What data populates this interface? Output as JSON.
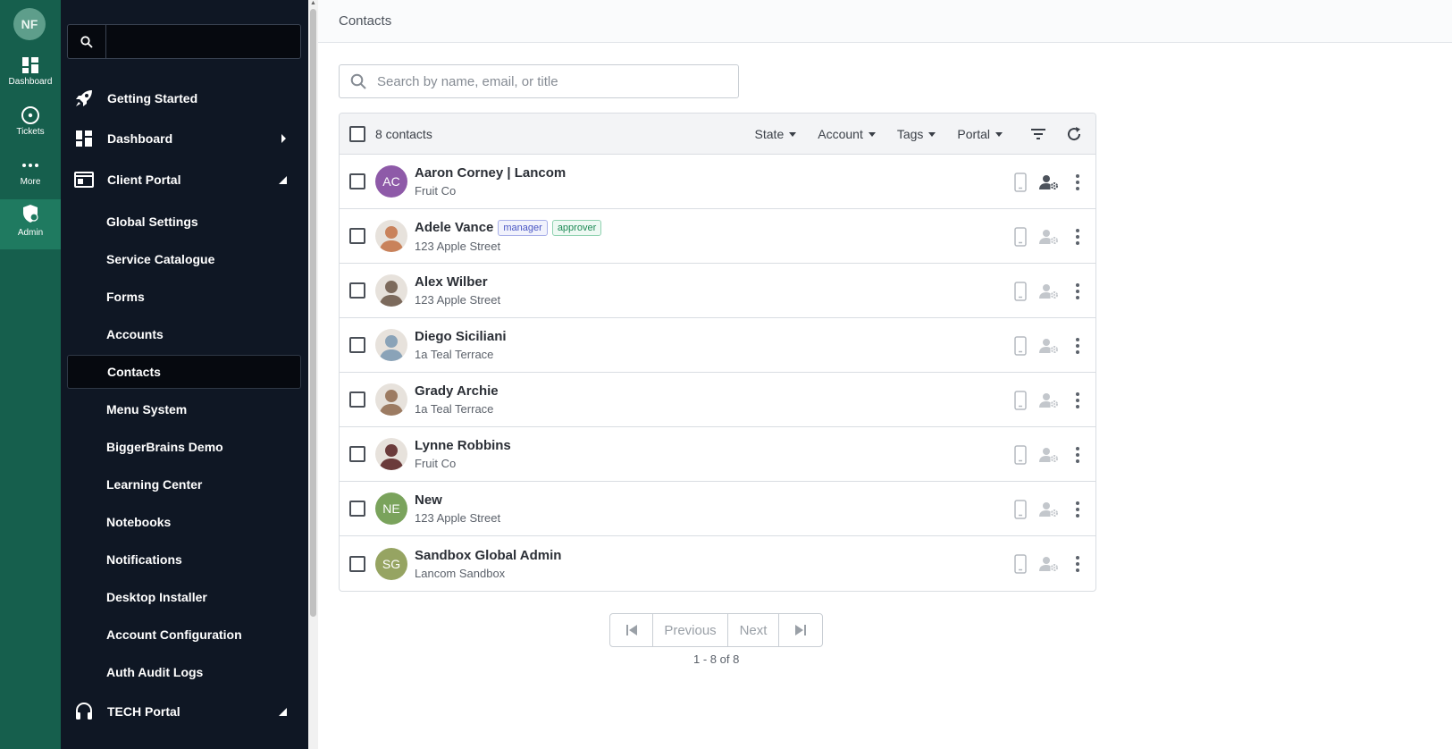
{
  "rail": {
    "avatar_initials": "NF",
    "items": [
      {
        "label": "Dashboard",
        "icon": "dashboard-grid-icon"
      },
      {
        "label": "Tickets",
        "icon": "ticket-circle-icon"
      },
      {
        "label": "More",
        "icon": "more-dots-icon"
      },
      {
        "label": "Admin",
        "icon": "admin-shield-icon"
      }
    ]
  },
  "sidebar": {
    "search_placeholder": "",
    "top_items": [
      {
        "label": "Getting Started",
        "icon": "rocket-icon"
      },
      {
        "label": "Dashboard",
        "icon": "dashboard-grid-icon"
      },
      {
        "label": "Client Portal",
        "icon": "browser-window-icon"
      },
      {
        "label": "TECH Portal",
        "icon": "headset-icon"
      }
    ],
    "sub_items": [
      "Global Settings",
      "Service Catalogue",
      "Forms",
      "Accounts",
      "Contacts",
      "Menu System",
      "BiggerBrains Demo",
      "Learning Center",
      "Notebooks",
      "Notifications",
      "Desktop Installer",
      "Account Configuration",
      "Auth Audit Logs"
    ],
    "active_item": "Contacts"
  },
  "page": {
    "title": "Contacts",
    "search_placeholder": "Search by name, email, or title"
  },
  "table": {
    "count_label": "8 contacts",
    "filters": [
      "State",
      "Account",
      "Tags",
      "Portal"
    ],
    "contacts": [
      {
        "name": "Aaron Corney | Lancom",
        "sub": "Fruit Co",
        "initials": "AC",
        "avatar_color": "#8e5aa8",
        "tags": []
      },
      {
        "name": "Adele Vance",
        "sub": "123 Apple Street",
        "initials": "",
        "avatar_color": "#c9825b",
        "tags": [
          "manager",
          "approver"
        ]
      },
      {
        "name": "Alex Wilber",
        "sub": "123 Apple Street",
        "initials": "",
        "avatar_color": "#7c6a5c",
        "tags": []
      },
      {
        "name": "Diego Siciliani",
        "sub": "1a Teal Terrace",
        "initials": "",
        "avatar_color": "#8aa3b8",
        "tags": []
      },
      {
        "name": "Grady Archie",
        "sub": "1a Teal Terrace",
        "initials": "",
        "avatar_color": "#9c7b62",
        "tags": []
      },
      {
        "name": "Lynne Robbins",
        "sub": "Fruit Co",
        "initials": "",
        "avatar_color": "#6b3b3b",
        "tags": []
      },
      {
        "name": "New",
        "sub": "123 Apple Street",
        "initials": "NE",
        "avatar_color": "#7aa35c",
        "tags": []
      },
      {
        "name": "Sandbox Global Admin",
        "sub": "Lancom Sandbox",
        "initials": "SG",
        "avatar_color": "#96a462",
        "tags": []
      }
    ]
  },
  "pagination": {
    "previous_label": "Previous",
    "next_label": "Next",
    "range_label": "1 - 8 of 8"
  }
}
